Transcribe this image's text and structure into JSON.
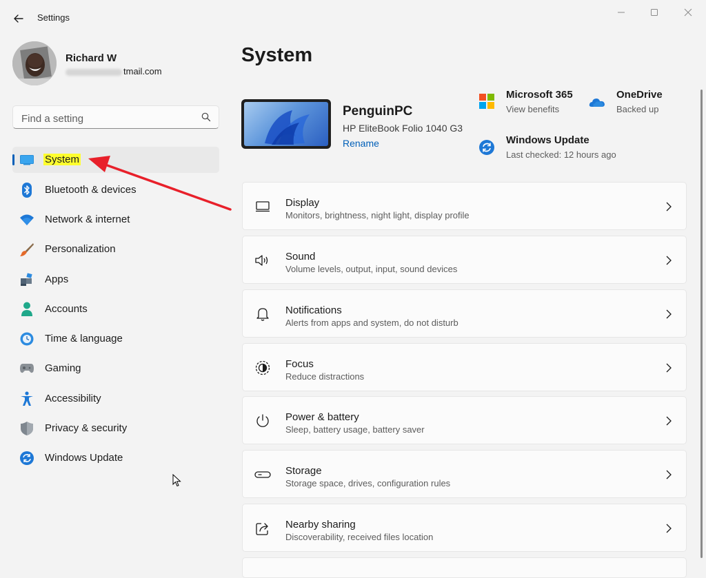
{
  "window": {
    "title": "Settings"
  },
  "profile": {
    "name": "Richard W",
    "email_visible": "tmail.com"
  },
  "search": {
    "placeholder": "Find a setting"
  },
  "nav": [
    {
      "label": "System",
      "icon": "system-icon",
      "selected": true
    },
    {
      "label": "Bluetooth & devices",
      "icon": "bluetooth-icon"
    },
    {
      "label": "Network & internet",
      "icon": "wifi-icon"
    },
    {
      "label": "Personalization",
      "icon": "paintbrush-icon"
    },
    {
      "label": "Apps",
      "icon": "apps-icon"
    },
    {
      "label": "Accounts",
      "icon": "person-icon"
    },
    {
      "label": "Time & language",
      "icon": "clock-globe-icon"
    },
    {
      "label": "Gaming",
      "icon": "gamepad-icon"
    },
    {
      "label": "Accessibility",
      "icon": "accessibility-icon"
    },
    {
      "label": "Privacy & security",
      "icon": "shield-icon"
    },
    {
      "label": "Windows Update",
      "icon": "update-icon"
    }
  ],
  "page": {
    "title": "System"
  },
  "device": {
    "name": "PenguinPC",
    "model": "HP EliteBook Folio 1040 G3",
    "rename_label": "Rename"
  },
  "quick_links": [
    {
      "title": "Microsoft 365",
      "subtitle": "View benefits",
      "icon": "microsoft-logo-icon"
    },
    {
      "title": "OneDrive",
      "subtitle": "Backed up",
      "icon": "onedrive-cloud-icon"
    },
    {
      "title": "Windows Update",
      "subtitle": "Last checked: 12 hours ago",
      "icon": "windows-update-icon"
    }
  ],
  "cards": [
    {
      "title": "Display",
      "subtitle": "Monitors, brightness, night light, display profile",
      "icon": "monitor-icon"
    },
    {
      "title": "Sound",
      "subtitle": "Volume levels, output, input, sound devices",
      "icon": "speaker-icon"
    },
    {
      "title": "Notifications",
      "subtitle": "Alerts from apps and system, do not disturb",
      "icon": "bell-icon"
    },
    {
      "title": "Focus",
      "subtitle": "Reduce distractions",
      "icon": "focus-icon"
    },
    {
      "title": "Power & battery",
      "subtitle": "Sleep, battery usage, battery saver",
      "icon": "power-icon"
    },
    {
      "title": "Storage",
      "subtitle": "Storage space, drives, configuration rules",
      "icon": "storage-drive-icon"
    },
    {
      "title": "Nearby sharing",
      "subtitle": "Discoverability, received files location",
      "icon": "share-icon"
    }
  ],
  "colors": {
    "accent": "#005fb8",
    "highlight": "#ffff2e",
    "annotation_arrow": "#e8202a"
  }
}
